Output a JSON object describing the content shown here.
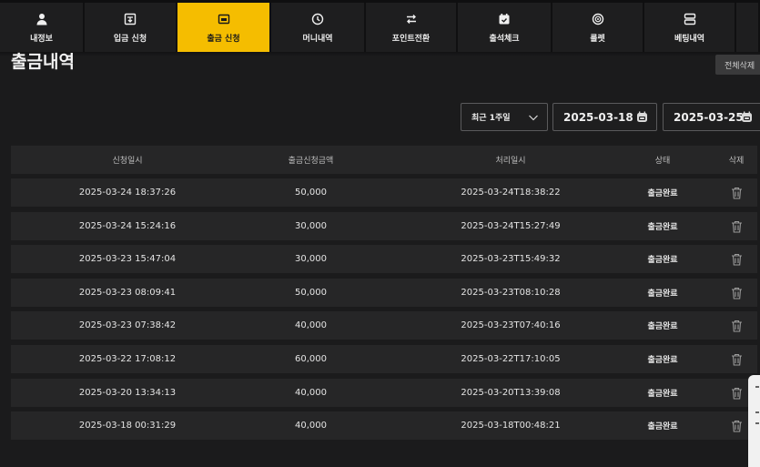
{
  "nav": {
    "tabs": [
      {
        "label": "내정보",
        "icon": "user-icon",
        "active": false
      },
      {
        "label": "입금 신청",
        "icon": "deposit-icon",
        "active": false
      },
      {
        "label": "출금 신청",
        "icon": "withdraw-icon",
        "active": true
      },
      {
        "label": "머니내역",
        "icon": "clock-icon",
        "active": false
      },
      {
        "label": "포인트전환",
        "icon": "exchange-icon",
        "active": false
      },
      {
        "label": "출석체크",
        "icon": "calendar-check-icon",
        "active": false
      },
      {
        "label": "룰렛",
        "icon": "roulette-icon",
        "active": false
      },
      {
        "label": "베팅내역",
        "icon": "list-icon",
        "active": false
      }
    ]
  },
  "page": {
    "title": "출금내역",
    "delete_all_label": "전체삭제"
  },
  "filter": {
    "period": "최근 1주일",
    "date_from": "2025-03-18",
    "date_to": "2025-03-25"
  },
  "table": {
    "headers": [
      "신청일시",
      "출금신청금액",
      "처리일시",
      "상태",
      "삭제"
    ],
    "rows": [
      {
        "requested": "2025-03-24 18:37:26",
        "amount": "50,000",
        "processed": "2025-03-24T18:38:22",
        "status": "출금완료"
      },
      {
        "requested": "2025-03-24 15:24:16",
        "amount": "30,000",
        "processed": "2025-03-24T15:27:49",
        "status": "출금완료"
      },
      {
        "requested": "2025-03-23 15:47:04",
        "amount": "30,000",
        "processed": "2025-03-23T15:49:32",
        "status": "출금완료"
      },
      {
        "requested": "2025-03-23 08:09:41",
        "amount": "50,000",
        "processed": "2025-03-23T08:10:28",
        "status": "출금완료"
      },
      {
        "requested": "2025-03-23 07:38:42",
        "amount": "40,000",
        "processed": "2025-03-23T07:40:16",
        "status": "출금완료"
      },
      {
        "requested": "2025-03-22 17:08:12",
        "amount": "60,000",
        "processed": "2025-03-22T17:10:05",
        "status": "출금완료"
      },
      {
        "requested": "2025-03-20 13:34:13",
        "amount": "40,000",
        "processed": "2025-03-20T13:39:08",
        "status": "출금완료"
      },
      {
        "requested": "2025-03-18 00:31:29",
        "amount": "40,000",
        "processed": "2025-03-18T00:48:21",
        "status": "출금완료"
      }
    ]
  },
  "colors": {
    "accent": "#f5bd00",
    "background": "#1b1b1c",
    "row": "#262627"
  }
}
